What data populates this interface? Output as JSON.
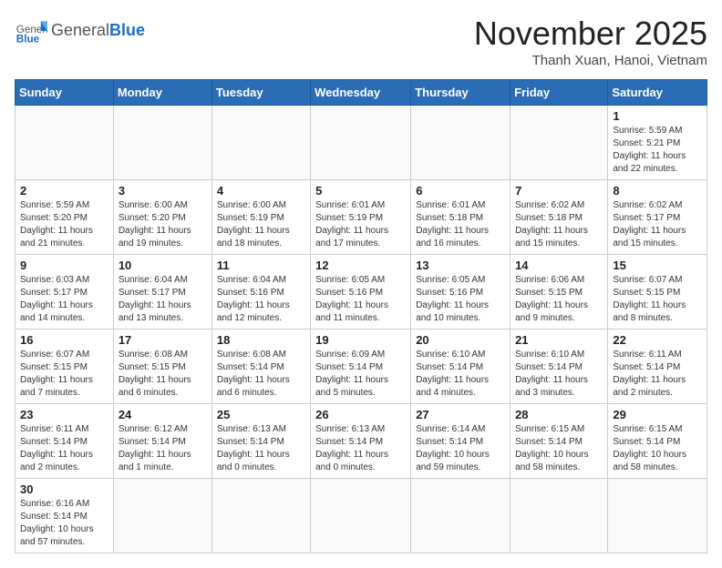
{
  "header": {
    "logo_general": "General",
    "logo_blue": "Blue",
    "month_title": "November 2025",
    "location": "Thanh Xuan, Hanoi, Vietnam"
  },
  "weekdays": [
    "Sunday",
    "Monday",
    "Tuesday",
    "Wednesday",
    "Thursday",
    "Friday",
    "Saturday"
  ],
  "days": {
    "1": {
      "sunrise": "5:59 AM",
      "sunset": "5:21 PM",
      "daylight": "11 hours and 22 minutes."
    },
    "2": {
      "sunrise": "5:59 AM",
      "sunset": "5:20 PM",
      "daylight": "11 hours and 21 minutes."
    },
    "3": {
      "sunrise": "6:00 AM",
      "sunset": "5:20 PM",
      "daylight": "11 hours and 19 minutes."
    },
    "4": {
      "sunrise": "6:00 AM",
      "sunset": "5:19 PM",
      "daylight": "11 hours and 18 minutes."
    },
    "5": {
      "sunrise": "6:01 AM",
      "sunset": "5:19 PM",
      "daylight": "11 hours and 17 minutes."
    },
    "6": {
      "sunrise": "6:01 AM",
      "sunset": "5:18 PM",
      "daylight": "11 hours and 16 minutes."
    },
    "7": {
      "sunrise": "6:02 AM",
      "sunset": "5:18 PM",
      "daylight": "11 hours and 15 minutes."
    },
    "8": {
      "sunrise": "6:02 AM",
      "sunset": "5:17 PM",
      "daylight": "11 hours and 15 minutes."
    },
    "9": {
      "sunrise": "6:03 AM",
      "sunset": "5:17 PM",
      "daylight": "11 hours and 14 minutes."
    },
    "10": {
      "sunrise": "6:04 AM",
      "sunset": "5:17 PM",
      "daylight": "11 hours and 13 minutes."
    },
    "11": {
      "sunrise": "6:04 AM",
      "sunset": "5:16 PM",
      "daylight": "11 hours and 12 minutes."
    },
    "12": {
      "sunrise": "6:05 AM",
      "sunset": "5:16 PM",
      "daylight": "11 hours and 11 minutes."
    },
    "13": {
      "sunrise": "6:05 AM",
      "sunset": "5:16 PM",
      "daylight": "11 hours and 10 minutes."
    },
    "14": {
      "sunrise": "6:06 AM",
      "sunset": "5:15 PM",
      "daylight": "11 hours and 9 minutes."
    },
    "15": {
      "sunrise": "6:07 AM",
      "sunset": "5:15 PM",
      "daylight": "11 hours and 8 minutes."
    },
    "16": {
      "sunrise": "6:07 AM",
      "sunset": "5:15 PM",
      "daylight": "11 hours and 7 minutes."
    },
    "17": {
      "sunrise": "6:08 AM",
      "sunset": "5:15 PM",
      "daylight": "11 hours and 6 minutes."
    },
    "18": {
      "sunrise": "6:08 AM",
      "sunset": "5:14 PM",
      "daylight": "11 hours and 6 minutes."
    },
    "19": {
      "sunrise": "6:09 AM",
      "sunset": "5:14 PM",
      "daylight": "11 hours and 5 minutes."
    },
    "20": {
      "sunrise": "6:10 AM",
      "sunset": "5:14 PM",
      "daylight": "11 hours and 4 minutes."
    },
    "21": {
      "sunrise": "6:10 AM",
      "sunset": "5:14 PM",
      "daylight": "11 hours and 3 minutes."
    },
    "22": {
      "sunrise": "6:11 AM",
      "sunset": "5:14 PM",
      "daylight": "11 hours and 2 minutes."
    },
    "23": {
      "sunrise": "6:11 AM",
      "sunset": "5:14 PM",
      "daylight": "11 hours and 2 minutes."
    },
    "24": {
      "sunrise": "6:12 AM",
      "sunset": "5:14 PM",
      "daylight": "11 hours and 1 minute."
    },
    "25": {
      "sunrise": "6:13 AM",
      "sunset": "5:14 PM",
      "daylight": "11 hours and 0 minutes."
    },
    "26": {
      "sunrise": "6:13 AM",
      "sunset": "5:14 PM",
      "daylight": "11 hours and 0 minutes."
    },
    "27": {
      "sunrise": "6:14 AM",
      "sunset": "5:14 PM",
      "daylight": "10 hours and 59 minutes."
    },
    "28": {
      "sunrise": "6:15 AM",
      "sunset": "5:14 PM",
      "daylight": "10 hours and 58 minutes."
    },
    "29": {
      "sunrise": "6:15 AM",
      "sunset": "5:14 PM",
      "daylight": "10 hours and 58 minutes."
    },
    "30": {
      "sunrise": "6:16 AM",
      "sunset": "5:14 PM",
      "daylight": "10 hours and 57 minutes."
    }
  }
}
